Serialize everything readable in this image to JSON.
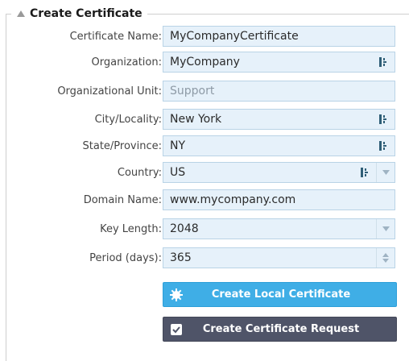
{
  "panel": {
    "title": "Create Certificate"
  },
  "form": {
    "certificate_name": {
      "label": "Certificate Name:",
      "value": "MyCompanyCertificate"
    },
    "organization": {
      "label": "Organization:",
      "value": "MyCompany"
    },
    "organizational_unit": {
      "label": "Organizational Unit:",
      "placeholder": "Support"
    },
    "city": {
      "label": "City/Locality:",
      "value": "New York"
    },
    "state": {
      "label": "State/Province:",
      "value": "NY"
    },
    "country": {
      "label": "Country:",
      "value": "US"
    },
    "domain_name": {
      "label": "Domain Name:",
      "value": "www.mycompany.com"
    },
    "key_length": {
      "label": "Key Length:",
      "value": "2048"
    },
    "period": {
      "label": "Period (days):",
      "value": "365"
    }
  },
  "buttons": {
    "create_local": "Create Local Certificate",
    "create_request": "Create Certificate Request"
  },
  "icons": {
    "collapse": "triangle-up-icon",
    "field_picker": "password-manager-icon",
    "dropdown": "chevron-down-icon",
    "spinner": "spinner-arrows-icon",
    "local_cert": "gear-icon",
    "request": "checkbox-icon"
  },
  "colors": {
    "field_bg": "#e6f1fa",
    "field_border": "#b9d3e6",
    "primary_button": "#3faee6",
    "secondary_button": "#4f5468",
    "icon_accent": "#2f5e77"
  }
}
